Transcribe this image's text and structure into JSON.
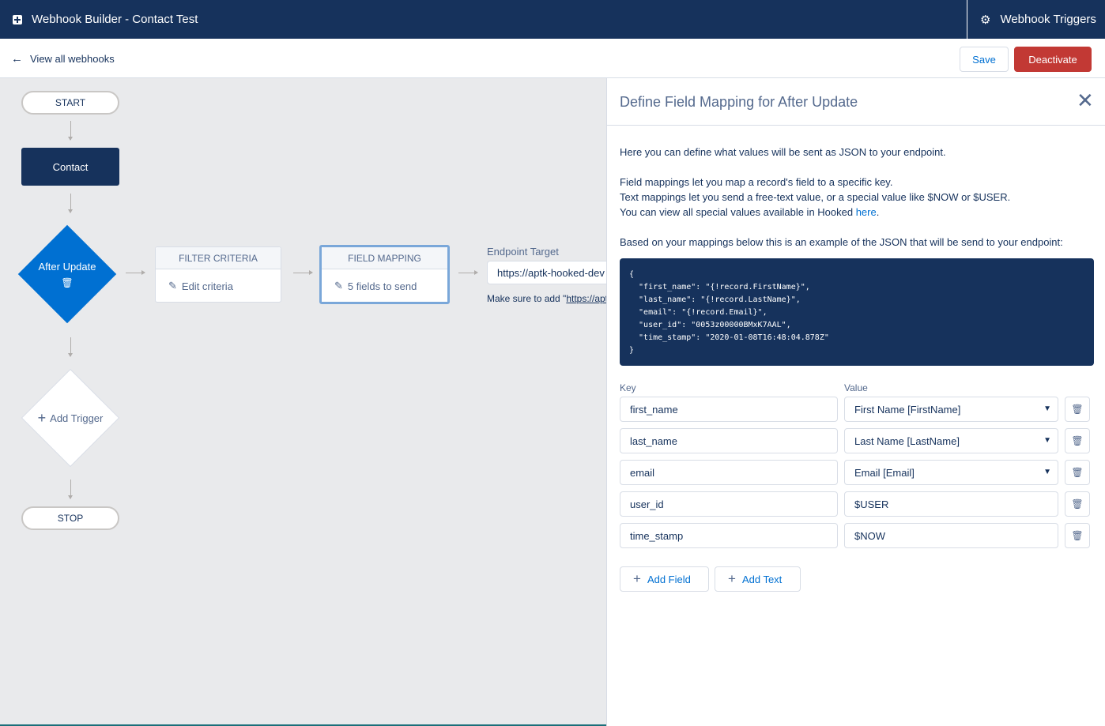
{
  "header": {
    "app_title": "Webhook Builder - Contact Test",
    "triggers_label": "Webhook Triggers"
  },
  "subheader": {
    "back_label": "View all webhooks",
    "save_label": "Save",
    "deactivate_label": "Deactivate"
  },
  "flow": {
    "start_label": "START",
    "object_label": "Contact",
    "trigger_label": "After Update",
    "add_trigger_label": "Add Trigger",
    "stop_label": "STOP",
    "filter_card": {
      "title": "FILTER CRITERIA",
      "action": "Edit criteria"
    },
    "mapping_card": {
      "title": "FIELD MAPPING",
      "action": "5 fields to send"
    },
    "endpoint": {
      "label": "Endpoint Target",
      "value": "https://aptk-hooked-dev",
      "hint_prefix": "Make sure to add \"",
      "hint_link": "https://apt"
    }
  },
  "panel": {
    "title": "Define Field Mapping for After Update",
    "intro": "Here you can define what values will be sent as JSON to your endpoint.",
    "line1": "Field mappings let you map a record's field to a specific key.",
    "line2": "Text mappings let you send a free-text value, or a special value like $NOW or $USER.",
    "line3_prefix": "You can view all special values available in Hooked ",
    "line3_link": "here",
    "line3_suffix": ".",
    "example_label": "Based on your mappings below this is an example of the JSON that will be send to your endpoint:",
    "json_example": "{\n  \"first_name\": \"{!record.FirstName}\",\n  \"last_name\": \"{!record.LastName}\",\n  \"email\": \"{!record.Email}\",\n  \"user_id\": \"0053z00000BMxK7AAL\",\n  \"time_stamp\": \"2020-01-08T16:48:04.878Z\"\n}",
    "key_header": "Key",
    "value_header": "Value",
    "mappings": [
      {
        "key": "first_name",
        "value": "First Name [FirstName]",
        "type": "field"
      },
      {
        "key": "last_name",
        "value": "Last Name [LastName]",
        "type": "field"
      },
      {
        "key": "email",
        "value": "Email [Email]",
        "type": "field"
      },
      {
        "key": "user_id",
        "value": "$USER",
        "type": "text"
      },
      {
        "key": "time_stamp",
        "value": "$NOW",
        "type": "text"
      }
    ],
    "add_field_label": "Add Field",
    "add_text_label": "Add Text"
  },
  "colors": {
    "brand_navy": "#16325c",
    "accent_blue": "#0070d2",
    "danger_red": "#c23934",
    "canvas_gray": "#e9eaec"
  },
  "icons": [
    "app-icon",
    "gear-icon",
    "arrow-left-icon",
    "trash-icon",
    "plus-icon",
    "pencil-icon",
    "close-icon",
    "chevron-down-icon"
  ]
}
